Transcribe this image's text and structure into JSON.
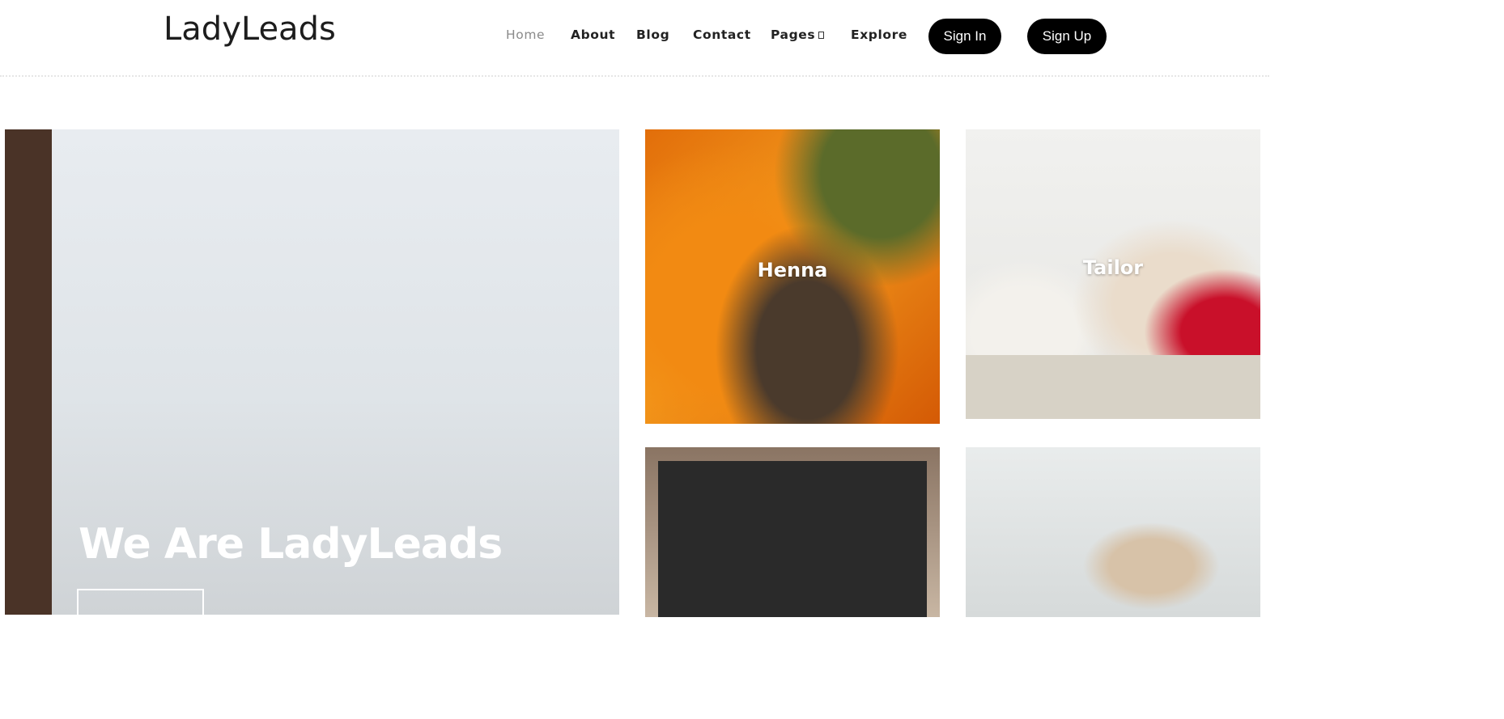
{
  "brand": {
    "name": "LadyLeads"
  },
  "nav": {
    "items": [
      {
        "label": "Home",
        "active": true
      },
      {
        "label": "About"
      },
      {
        "label": "Blog"
      },
      {
        "label": "Contact"
      },
      {
        "label": "Pages",
        "has_dropdown": true
      },
      {
        "label": "Explore"
      }
    ],
    "sign_in": "Sign In",
    "sign_up": "Sign Up"
  },
  "hero": {
    "title": "We Are LadyLeads"
  },
  "tiles": [
    {
      "label": "Henna"
    },
    {
      "label": "Tailor"
    }
  ],
  "colors": {
    "primary_button": "#000000",
    "nav_active": "#8a8a8a",
    "text": "#222222"
  },
  "icons": {
    "pages_dropdown": "chevron-down-icon"
  }
}
